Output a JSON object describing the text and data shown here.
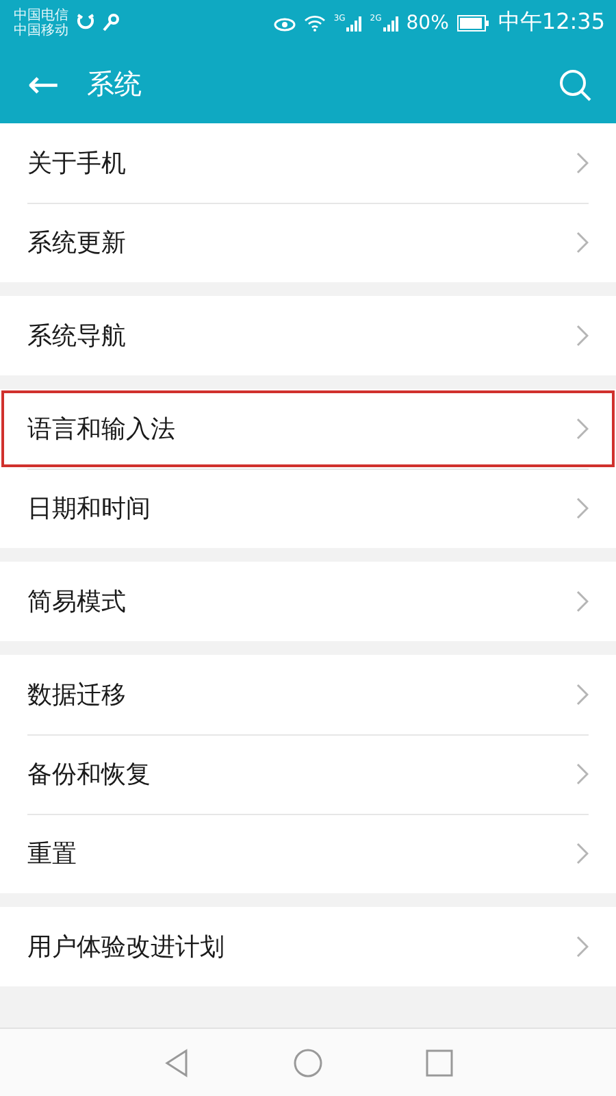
{
  "status_bar": {
    "carriers": [
      "中国电信",
      "中国移动"
    ],
    "network_1": "3G",
    "network_2": "2G",
    "battery": "80%",
    "time": "中午12:35"
  },
  "header": {
    "back": "←",
    "title": "系统"
  },
  "groups": [
    {
      "items": [
        {
          "label": "关于手机",
          "highlighted": false
        },
        {
          "label": "系统更新",
          "highlighted": false
        }
      ]
    },
    {
      "items": [
        {
          "label": "系统导航",
          "highlighted": false
        }
      ]
    },
    {
      "items": [
        {
          "label": "语言和输入法",
          "highlighted": true
        },
        {
          "label": "日期和时间",
          "highlighted": false
        }
      ]
    },
    {
      "items": [
        {
          "label": "简易模式",
          "highlighted": false
        }
      ]
    },
    {
      "items": [
        {
          "label": "数据迁移",
          "highlighted": false
        },
        {
          "label": "备份和恢复",
          "highlighted": false
        },
        {
          "label": "重置",
          "highlighted": false
        }
      ]
    },
    {
      "items": [
        {
          "label": "用户体验改进计划",
          "highlighted": false
        }
      ]
    }
  ]
}
